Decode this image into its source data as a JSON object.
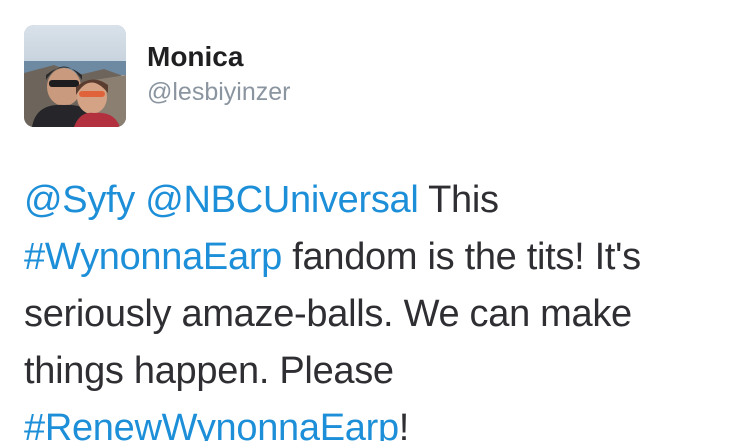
{
  "author": {
    "display_name": "Monica",
    "handle": "@lesbiyinzer",
    "avatar_icon": "profile-photo"
  },
  "tweet": {
    "mention_1": "@Syfy",
    "mention_2": "@NBCUniversal",
    "text_1": " This",
    "hashtag_1": "#WynonnaEarp",
    "text_2": " fandom is the tits! It's",
    "text_3": "seriously amaze-balls. We can make",
    "text_4": "things happen. Please",
    "hashtag_2": "#RenewWynonnaEarp",
    "text_5": "!"
  },
  "colors": {
    "link": "#1d8fd8",
    "text": "#2f2f33",
    "handle": "#8b95a0"
  }
}
